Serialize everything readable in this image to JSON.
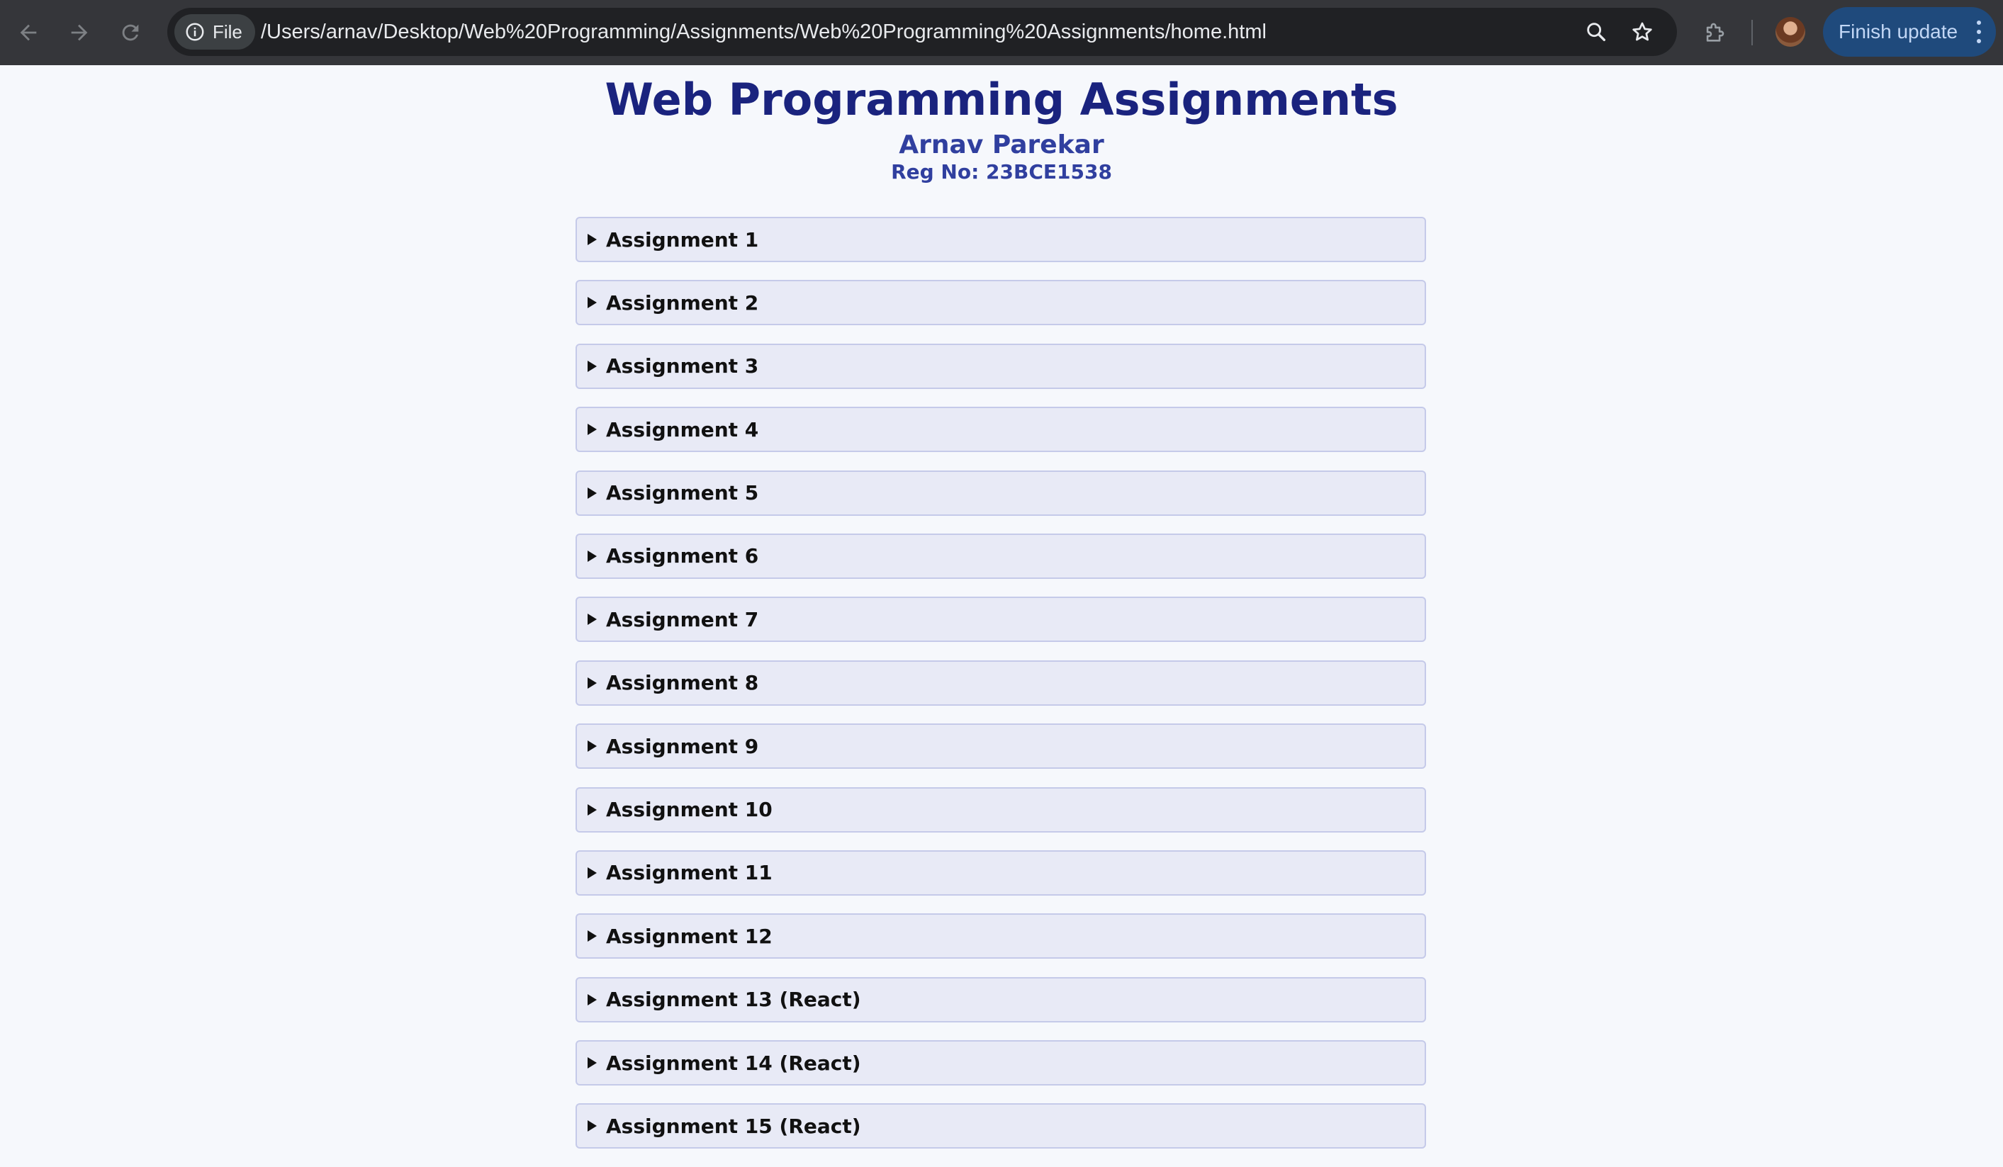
{
  "browser": {
    "site_chip_label": "File",
    "url": "/Users/arnav/Desktop/Web%20Programming/Assignments/Web%20Programming%20Assignments/home.html",
    "update_button_label": "Finish update",
    "icons": {
      "back": "back-arrow-icon",
      "forward": "forward-arrow-icon",
      "reload": "reload-icon",
      "site_info": "info-icon",
      "zoom": "zoom-icon",
      "bookmark": "star-icon",
      "extensions": "puzzle-icon",
      "menu": "kebab-menu-icon"
    },
    "colors": {
      "toolbar": "#35363a",
      "omnibox": "#202124",
      "update_button": "#1f4a7c"
    }
  },
  "page": {
    "title": "Web Programming Assignments",
    "author_name": "Arnav Parekar",
    "registration": "Reg No: 23BCE1538",
    "colors": {
      "title": "#1a237e",
      "subtitle": "#303f9f",
      "item_background": "#e8eaf6",
      "item_border": "#c5cae9"
    },
    "assignments": [
      {
        "label": "Assignment 1"
      },
      {
        "label": "Assignment 2"
      },
      {
        "label": "Assignment 3"
      },
      {
        "label": "Assignment 4"
      },
      {
        "label": "Assignment 5"
      },
      {
        "label": "Assignment 6"
      },
      {
        "label": "Assignment 7"
      },
      {
        "label": "Assignment 8"
      },
      {
        "label": "Assignment 9"
      },
      {
        "label": "Assignment 10"
      },
      {
        "label": "Assignment 11"
      },
      {
        "label": "Assignment 12"
      },
      {
        "label": "Assignment 13 (React)"
      },
      {
        "label": "Assignment 14 (React)"
      },
      {
        "label": "Assignment 15 (React)"
      }
    ]
  }
}
